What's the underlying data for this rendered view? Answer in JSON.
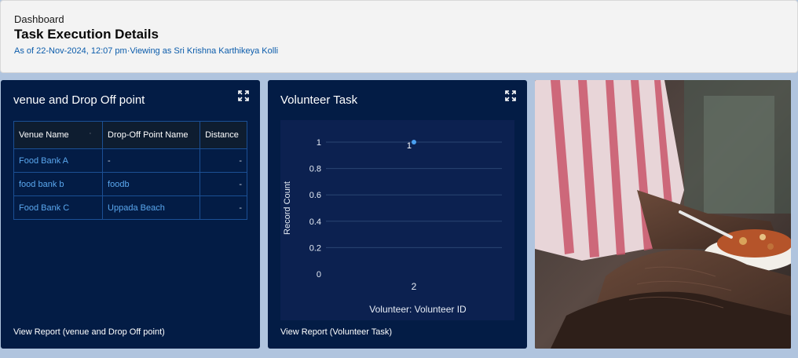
{
  "header": {
    "breadcrumb": "Dashboard",
    "title": "Task Execution Details",
    "subtitle": "As of 22-Nov-2024, 12:07 pm·Viewing as Sri Krishna Karthikeya Kolli"
  },
  "venue_panel": {
    "title": "venue and Drop Off point",
    "columns": [
      "Venue Name",
      "Drop-Off Point Name",
      "Distance"
    ],
    "rows": [
      {
        "venue": "Food Bank A",
        "dropoff": "-",
        "distance": "-"
      },
      {
        "venue": "food bank b",
        "dropoff": "foodb",
        "distance": "-"
      },
      {
        "venue": "Food Bank C",
        "dropoff": "Uppada Beach",
        "distance": "-"
      }
    ],
    "view_report": "View Report (venue and Drop Off point)"
  },
  "volunteer_panel": {
    "title": "Volunteer Task",
    "view_report": "View Report (Volunteer Task)"
  },
  "chart_data": {
    "type": "scatter",
    "title": "",
    "xlabel": "Volunteer: Volunteer ID",
    "ylabel": "Record Count",
    "categories": [
      "2"
    ],
    "values": [
      1
    ],
    "data_labels": [
      "1"
    ],
    "yticks": [
      "0",
      "0.2",
      "0.4",
      "0.6",
      "0.8",
      "1"
    ],
    "ylim": [
      0,
      1
    ],
    "grid": true,
    "point_color": "#4aa0f0"
  },
  "image_panel": {
    "icon": "food-donation-photo"
  }
}
